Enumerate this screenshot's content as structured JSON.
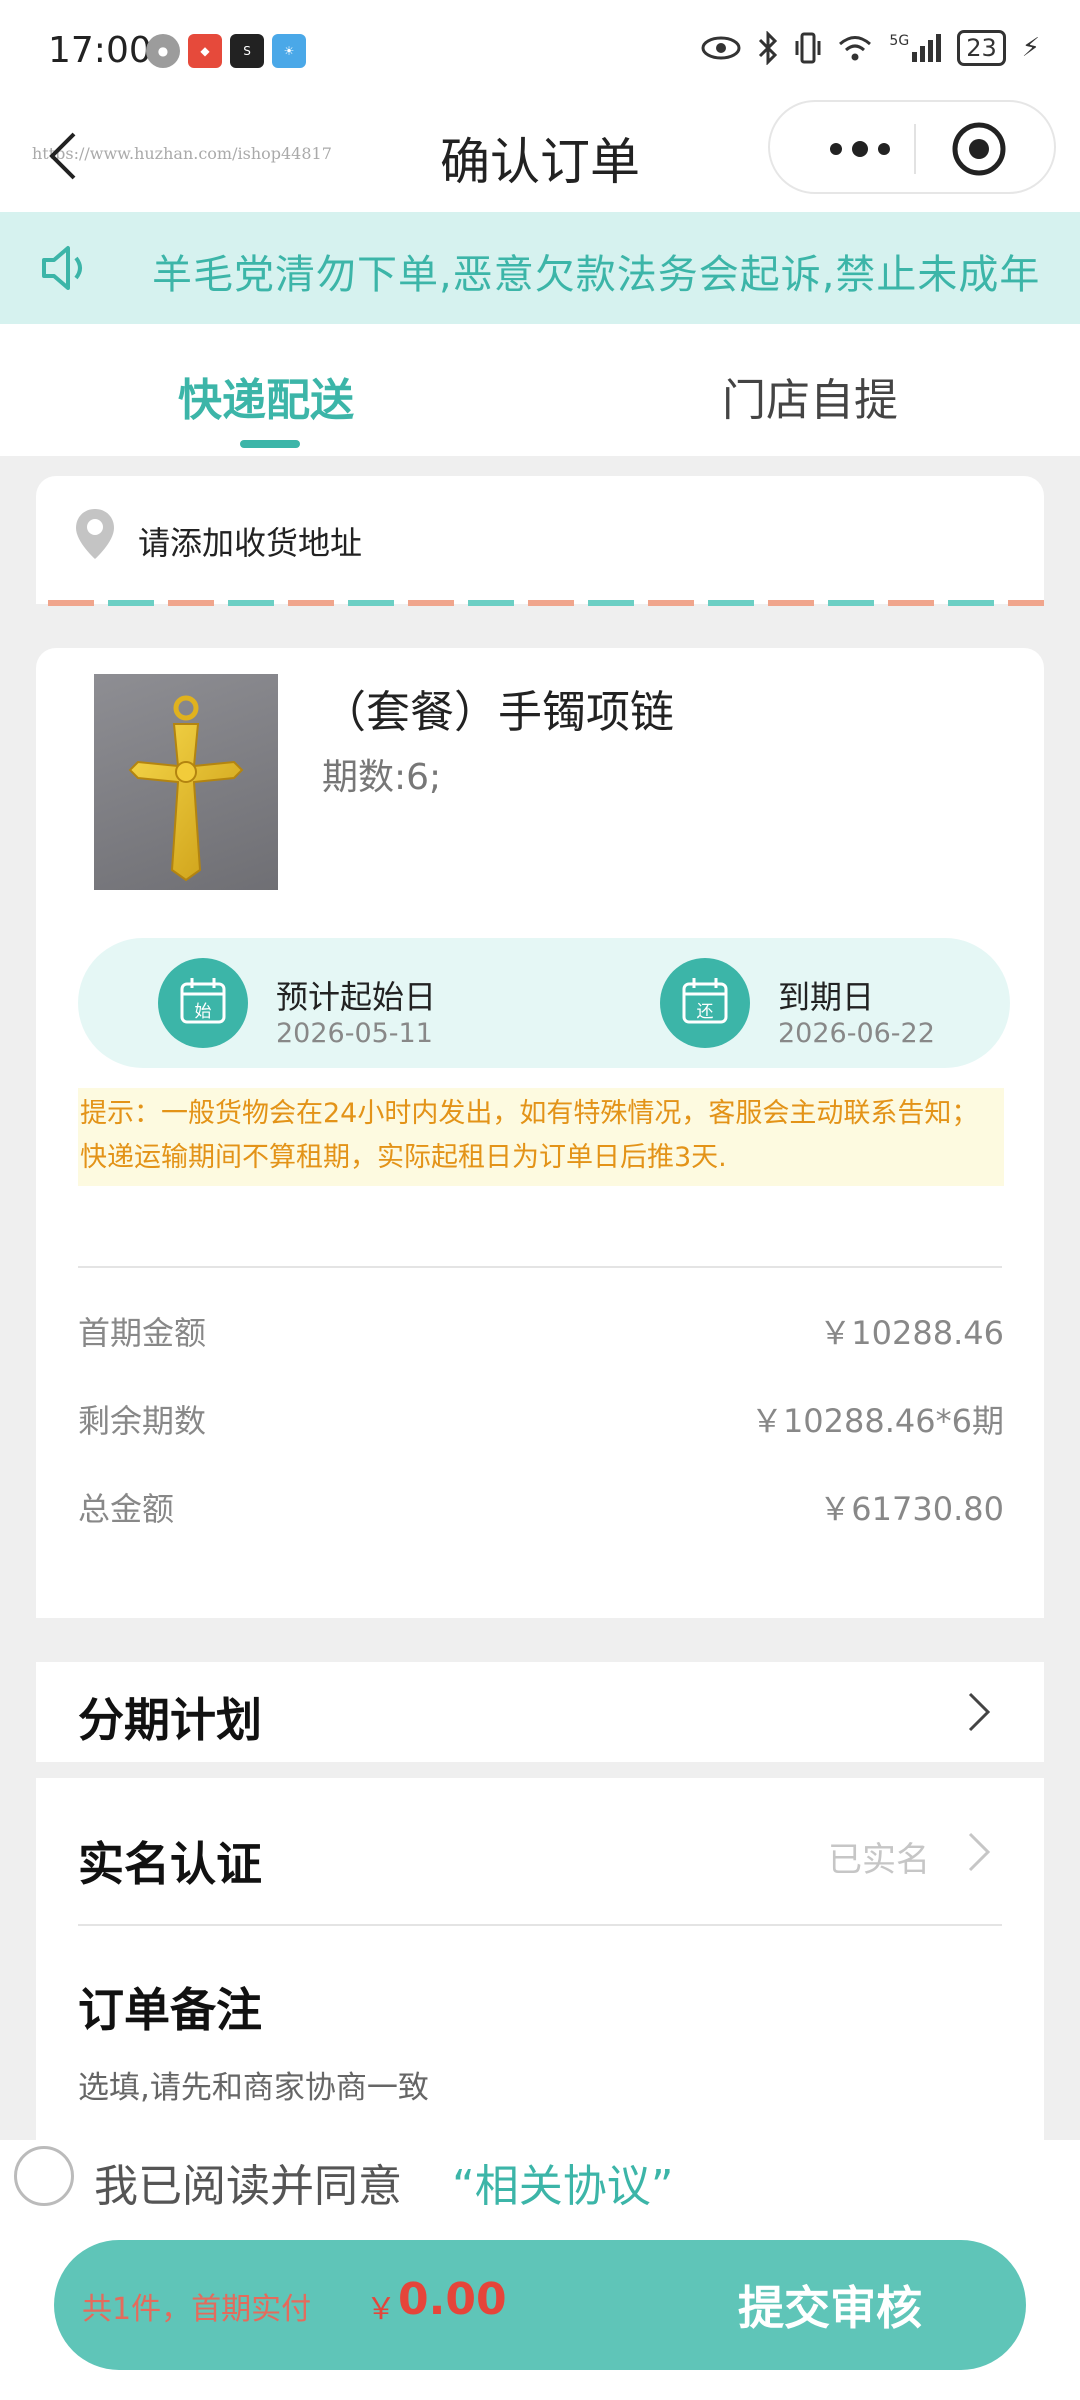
{
  "status_bar": {
    "time": "17:00",
    "network": "5G",
    "battery": "23"
  },
  "nav": {
    "title": "确认订单",
    "watermark": "https://www.huzhan.com/ishop44817"
  },
  "notice": {
    "text": "羊毛党清勿下单,恶意欠款法务会起诉,禁止未成年"
  },
  "tabs": {
    "active": "快递配送",
    "inactive": "门店自提"
  },
  "address": {
    "placeholder": "请添加收货地址"
  },
  "product": {
    "title": "（套餐）手镯项链",
    "periods": "期数:6;",
    "start_label": "预计起始日",
    "start_date": "2026-05-11",
    "start_icon_char": "始",
    "end_label": "到期日",
    "end_date": "2026-06-22",
    "end_icon_char": "还",
    "tip": "提示：一般货物会在24小时内发出，如有特殊情况，客服会主动联系告知；快递运输期间不算租期，实际起租日为订单日后推3天."
  },
  "amounts": [
    {
      "label": "首期金额",
      "value": "￥10288.46"
    },
    {
      "label": "剩余期数",
      "value": "￥10288.46*6期"
    },
    {
      "label": "总金额",
      "value": "￥61730.80"
    }
  ],
  "sections": {
    "plan": {
      "title": "分期计划"
    },
    "realname": {
      "title": "实名认证",
      "status": "已实名"
    },
    "remark": {
      "title": "订单备注",
      "desc": "选填,请先和商家协商一致"
    }
  },
  "agreement": {
    "text": "我已阅读并同意",
    "link": "“相关协议”"
  },
  "bottom": {
    "summary": "共1件，首期实付",
    "currency": "￥",
    "amount": "0.00",
    "submit": "提交审核"
  },
  "colors": {
    "accent": "#3cb5a8",
    "price": "#e5453a",
    "tip_text": "#e39318",
    "notice_bg": "#d6f2ef"
  }
}
